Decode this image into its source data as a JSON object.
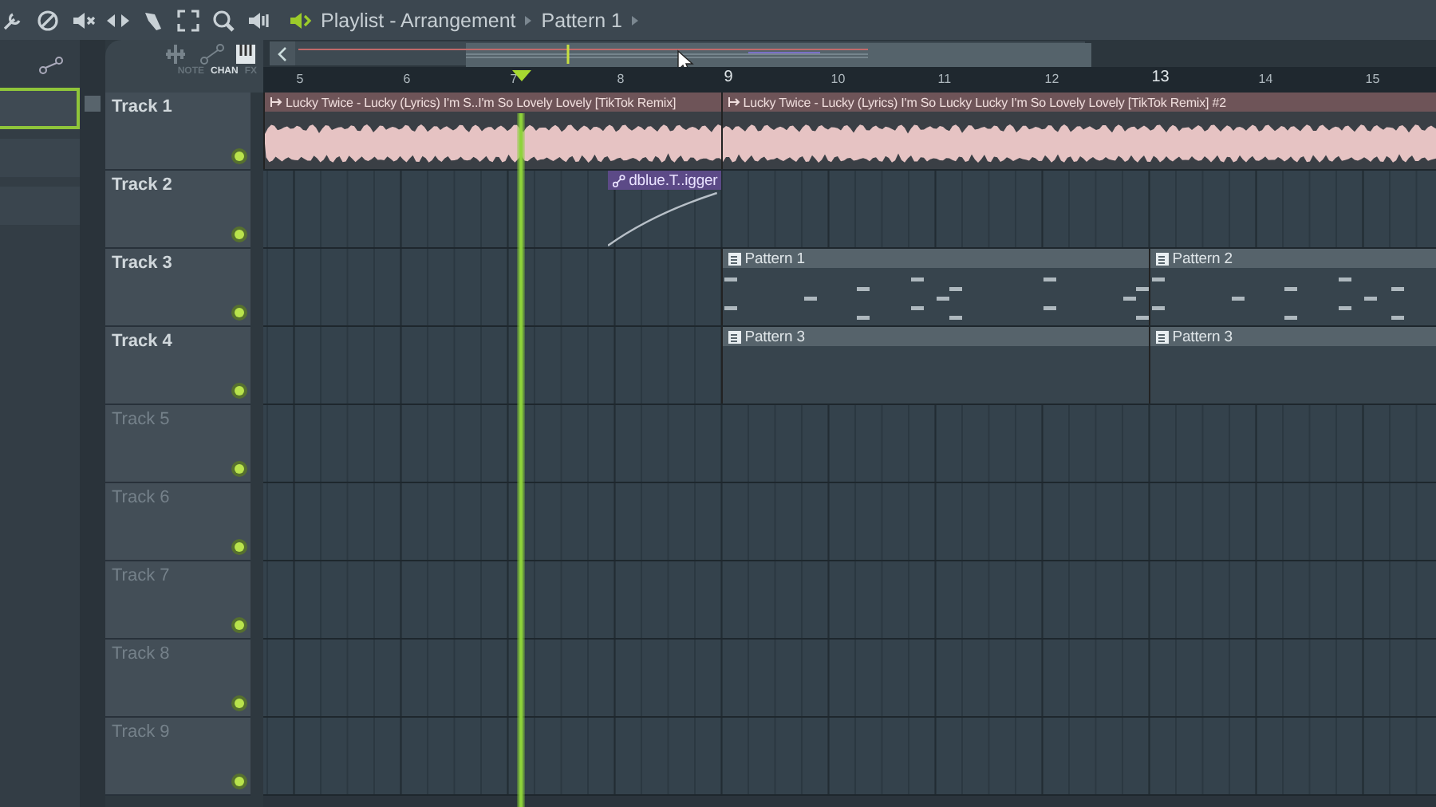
{
  "toolbar": {
    "breadcrumb": [
      {
        "label": "Playlist - Arrangement"
      },
      {
        "label": "Pattern 1"
      }
    ]
  },
  "view_tabs": [
    {
      "label": "NOTE",
      "selected": false
    },
    {
      "label": "CHAN",
      "selected": true
    },
    {
      "label": "FX",
      "selected": false
    }
  ],
  "ruler": [
    {
      "label": "5",
      "major": false
    },
    {
      "label": "6",
      "major": false
    },
    {
      "label": "7",
      "major": false
    },
    {
      "label": "8",
      "major": false
    },
    {
      "label": "9",
      "major": true
    },
    {
      "label": "10",
      "major": false
    },
    {
      "label": "11",
      "major": false
    },
    {
      "label": "12",
      "major": false
    },
    {
      "label": "13",
      "major": true
    },
    {
      "label": "14",
      "major": false
    },
    {
      "label": "15",
      "major": false
    }
  ],
  "tracks": [
    {
      "name": "Track 1",
      "has_content": true,
      "enabled": true,
      "clips": [
        {
          "kind": "audio",
          "label": "Lucky Twice - Lucky (Lyrics) I'm S..I'm So Lovely Lovely [TikTok Remix]"
        },
        {
          "kind": "audio",
          "label": "Lucky Twice - Lucky (Lyrics) I'm So Lucky Lucky I'm So Lovely Lovely [TikTok Remix] #2"
        }
      ]
    },
    {
      "name": "Track 2",
      "has_content": true,
      "enabled": true,
      "clips": [
        {
          "kind": "automation",
          "label": "dblue.T..igger"
        }
      ]
    },
    {
      "name": "Track 3",
      "has_content": true,
      "enabled": true,
      "clips": [
        {
          "kind": "pattern",
          "label": "Pattern 1"
        },
        {
          "kind": "pattern",
          "label": "Pattern 2"
        }
      ]
    },
    {
      "name": "Track 4",
      "has_content": true,
      "enabled": true,
      "clips": [
        {
          "kind": "pattern",
          "label": "Pattern 3"
        },
        {
          "kind": "pattern",
          "label": "Pattern 3"
        }
      ]
    },
    {
      "name": "Track 5",
      "has_content": false,
      "enabled": true
    },
    {
      "name": "Track 6",
      "has_content": false,
      "enabled": true
    },
    {
      "name": "Track 7",
      "has_content": false,
      "enabled": true
    },
    {
      "name": "Track 8",
      "has_content": false,
      "enabled": true
    },
    {
      "name": "Track 9",
      "has_content": false,
      "enabled": true
    }
  ]
}
